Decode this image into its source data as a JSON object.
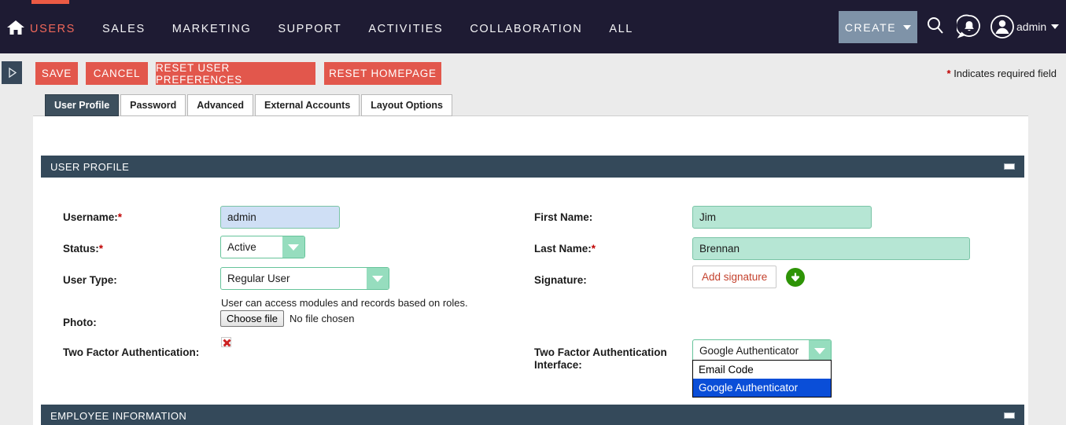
{
  "navbar": {
    "home_icon": "home-icon",
    "items": [
      {
        "label": "USERS",
        "active": true
      },
      {
        "label": "SALES",
        "active": false
      },
      {
        "label": "MARKETING",
        "active": false
      },
      {
        "label": "SUPPORT",
        "active": false
      },
      {
        "label": "ACTIVITIES",
        "active": false
      },
      {
        "label": "COLLABORATION",
        "active": false
      },
      {
        "label": "ALL",
        "active": false
      }
    ],
    "create_label": "CREATE",
    "user_label": "admin",
    "accent_color": "#ec5a44",
    "bg_color": "#1e1b33"
  },
  "toolbar": {
    "save_label": "SAVE",
    "cancel_label": "CANCEL",
    "reset_prefs_label": "RESET USER PREFERENCES",
    "reset_homepage_label": "RESET HOMEPAGE",
    "required_star": "*",
    "required_note": "Indicates required field",
    "button_color": "#e2574c"
  },
  "tabs": [
    {
      "label": "User Profile",
      "active": true
    },
    {
      "label": "Password",
      "active": false
    },
    {
      "label": "Advanced",
      "active": false
    },
    {
      "label": "External Accounts",
      "active": false
    },
    {
      "label": "Layout Options",
      "active": false
    }
  ],
  "sections": {
    "user_profile": {
      "title": "USER PROFILE",
      "collapse": "minus"
    },
    "employee_information": {
      "title": "EMPLOYEE INFORMATION",
      "collapse": "minus"
    }
  },
  "form": {
    "username": {
      "label": "Username:",
      "required": "*",
      "value": "admin"
    },
    "status": {
      "label": "Status:",
      "required": "*",
      "value": "Active"
    },
    "user_type": {
      "label": "User Type:",
      "value": "Regular User",
      "helper": "User can access modules and records based on roles."
    },
    "photo": {
      "label": "Photo:",
      "choose_label": "Choose file",
      "no_file": "No file chosen"
    },
    "two_factor": {
      "label": "Two Factor Authentication:",
      "icon": "broken-image-icon"
    },
    "first_name": {
      "label": "First Name:",
      "value": "Jim"
    },
    "last_name": {
      "label": "Last Name:",
      "required": "*",
      "value": "Brennan"
    },
    "signature": {
      "label": "Signature:",
      "button_label": "Add signature",
      "download_icon": "download-icon"
    },
    "two_factor_interface": {
      "label": "Two Factor Authentication Interface:",
      "value": "Google Authenticator",
      "options": [
        {
          "label": "Email Code",
          "selected": false
        },
        {
          "label": "Google Authenticator",
          "selected": true
        }
      ]
    }
  }
}
